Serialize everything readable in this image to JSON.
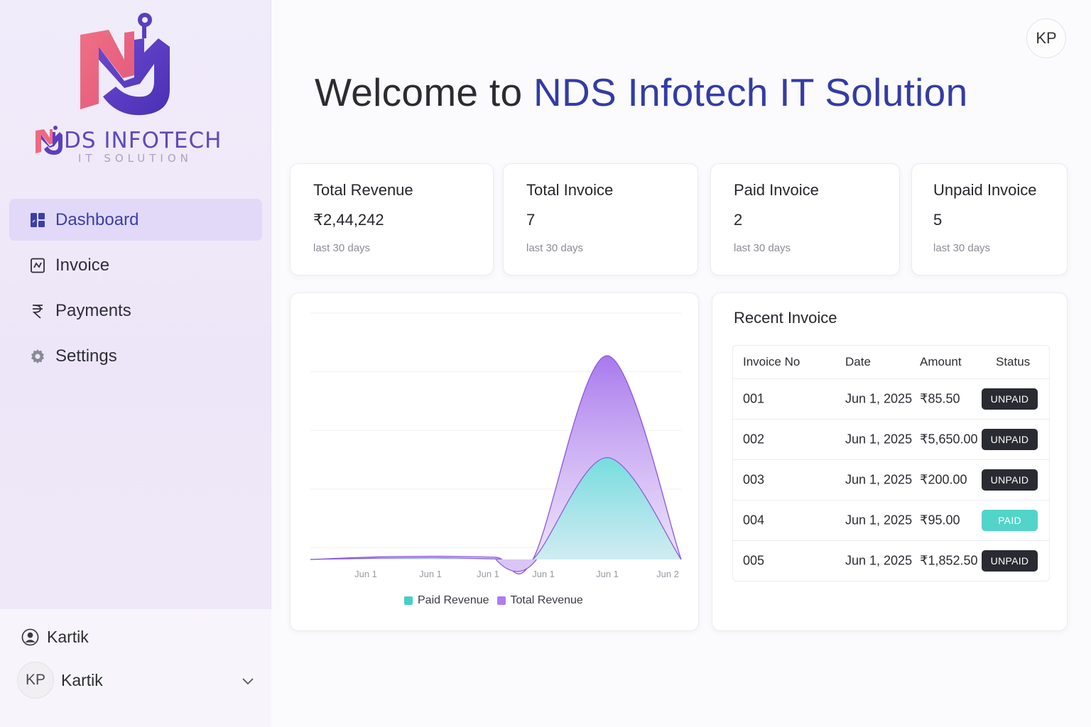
{
  "brand": {
    "name": "DS INFOTECH",
    "tagline": "IT SOLUTION",
    "colors": {
      "pink": "#ec6a86",
      "purple": "#5a3fc0"
    }
  },
  "sidebar": {
    "items": [
      {
        "label": "Dashboard",
        "icon": "dashboard-icon",
        "active": true
      },
      {
        "label": "Invoice",
        "icon": "invoice-icon",
        "active": false
      },
      {
        "label": "Payments",
        "icon": "rupee-icon",
        "active": false
      },
      {
        "label": "Settings",
        "icon": "gear-icon",
        "active": false
      }
    ],
    "user": {
      "name": "Kartik",
      "icon": "user-circle-icon"
    },
    "account": {
      "initials": "KP",
      "name": "Kartik"
    }
  },
  "header": {
    "avatar_initials": "KP",
    "welcome_prefix": "Welcome to ",
    "welcome_company": "NDS Infotech IT Solution"
  },
  "stats": [
    {
      "title": "Total Revenue",
      "value": "₹2,44,242",
      "note": "last 30 days"
    },
    {
      "title": "Total Invoice",
      "value": "7",
      "note": "last 30 days"
    },
    {
      "title": "Paid Invoice",
      "value": "2",
      "note": "last 30 days"
    },
    {
      "title": "Unpaid Invoice",
      "value": "5",
      "note": "last 30 days"
    }
  ],
  "chart_data": {
    "type": "area",
    "categories": [
      "Jun 1",
      "Jun 1",
      "Jun 1",
      "Jun 1",
      "Jun 1",
      "Jun 2"
    ],
    "series": [
      {
        "name": "Total Revenue",
        "color": "#b98ae6",
        "values": [
          0,
          1800,
          2200,
          1500,
          0,
          140000,
          0
        ]
      },
      {
        "name": "Paid Revenue",
        "color": "#5fd8d6",
        "values": [
          0,
          900,
          1200,
          400,
          0,
          70000,
          0
        ]
      }
    ],
    "legend": [
      "Paid Revenue",
      "Total Revenue"
    ],
    "legend_colors": [
      "#46cfc8",
      "#b07cf0"
    ],
    "grid": true,
    "legend_position": "bottom"
  },
  "recent": {
    "title": "Recent Invoice",
    "columns": [
      "Invoice No",
      "Date",
      "Amount",
      "Status"
    ],
    "rows": [
      {
        "no": "001",
        "date": "Jun 1, 2025",
        "amount": "₹85.50",
        "status": "UNPAID"
      },
      {
        "no": "002",
        "date": "Jun 1, 2025",
        "amount": "₹5,650.00",
        "status": "UNPAID"
      },
      {
        "no": "003",
        "date": "Jun 1, 2025",
        "amount": "₹200.00",
        "status": "UNPAID"
      },
      {
        "no": "004",
        "date": "Jun 1, 2025",
        "amount": "₹95.00",
        "status": "PAID"
      },
      {
        "no": "005",
        "date": "Jun 1, 2025",
        "amount": "₹1,852.50",
        "status": "UNPAID"
      }
    ]
  }
}
